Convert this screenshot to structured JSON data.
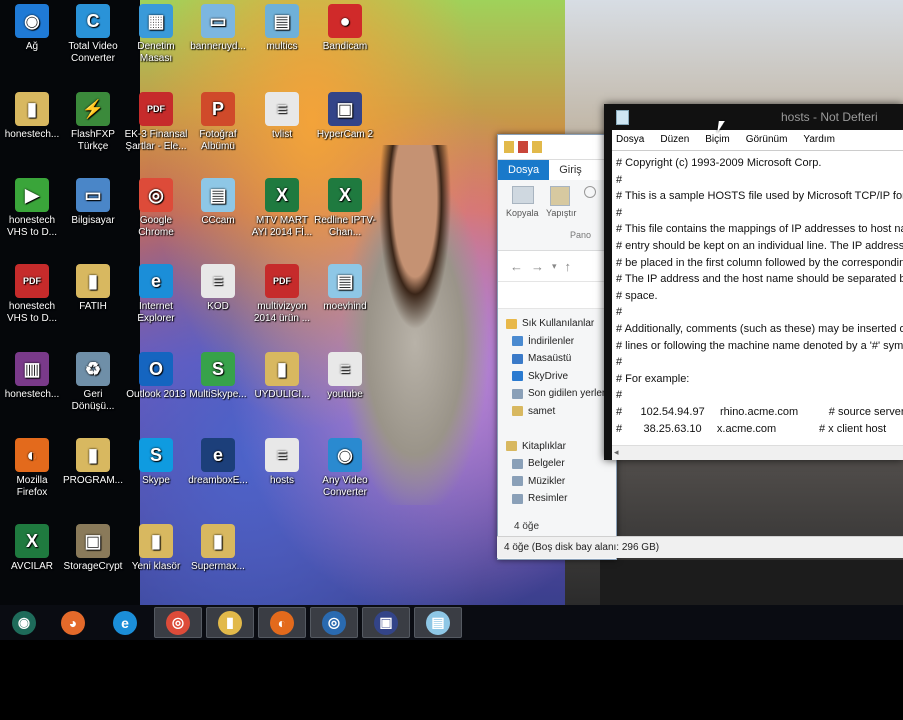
{
  "desktop": {
    "icons": [
      {
        "label": "Ağ",
        "icon": "network-icon",
        "color": "#1f7ad6",
        "glyph": "◉"
      },
      {
        "label": "Total Video Converter",
        "icon": "total-video-converter-icon",
        "color": "#2a93d8",
        "glyph": "C"
      },
      {
        "label": "Denetim Masası",
        "icon": "control-panel-icon",
        "color": "#3a9ad9",
        "glyph": "▦"
      },
      {
        "label": "banneruyd...",
        "icon": "image-file-icon",
        "color": "#7cb6e0",
        "glyph": "▭"
      },
      {
        "label": "multics",
        "icon": "document-icon",
        "color": "#6fb0d8",
        "glyph": "▤"
      },
      {
        "label": "Bandicam",
        "icon": "bandicam-icon",
        "color": "#d02a2a",
        "glyph": "●"
      },
      {
        "label": "honestech...",
        "icon": "folder-icon",
        "color": "#d8b860",
        "glyph": "▮"
      },
      {
        "label": "FlashFXP Türkçe",
        "icon": "flashfxp-icon",
        "color": "#3b8a3b",
        "glyph": "⚡"
      },
      {
        "label": "EK-3 Finansal Şartlar - Ele...",
        "icon": "pdf-icon",
        "color": "#c62b2b",
        "glyph": "PDF"
      },
      {
        "label": "Fotoğraf Albümü",
        "icon": "powerpoint-icon",
        "color": "#d04a2a",
        "glyph": "P"
      },
      {
        "label": "tvlist",
        "icon": "text-file-icon",
        "color": "#e8e8e8",
        "glyph": "≡"
      },
      {
        "label": "HyperCam 2",
        "icon": "hypercam-icon",
        "color": "#334488",
        "glyph": "▣"
      },
      {
        "label": "honestech VHS to D...",
        "icon": "honestech-icon",
        "color": "#3aa53a",
        "glyph": "▶"
      },
      {
        "label": "Bilgisayar",
        "icon": "computer-icon",
        "color": "#4a86c8",
        "glyph": "▭"
      },
      {
        "label": "Google Chrome",
        "icon": "chrome-icon",
        "color": "#dd4b39",
        "glyph": "◎"
      },
      {
        "label": "CCcam",
        "icon": "cccam-file-icon",
        "color": "#8ec7e6",
        "glyph": "▤"
      },
      {
        "label": "MTV MART AYI 2014 Fİ...",
        "icon": "excel-icon",
        "color": "#1f7a3f",
        "glyph": "X"
      },
      {
        "label": "Redline IPTV-Chan...",
        "icon": "excel-icon",
        "color": "#1f7a3f",
        "glyph": "X"
      },
      {
        "label": "honestech VHS to D...",
        "icon": "pdf-icon",
        "color": "#c62b2b",
        "glyph": "PDF"
      },
      {
        "label": "FATİH",
        "icon": "folder-icon",
        "color": "#d8b860",
        "glyph": "▮"
      },
      {
        "label": "Internet Explorer",
        "icon": "internet-explorer-icon",
        "color": "#1b8ed8",
        "glyph": "e"
      },
      {
        "label": "KOD",
        "icon": "text-file-icon",
        "color": "#e8e8e8",
        "glyph": "≡"
      },
      {
        "label": "multivizyon 2014 ürün ...",
        "icon": "pdf-icon",
        "color": "#c62b2b",
        "glyph": "PDF"
      },
      {
        "label": "moevhind",
        "icon": "cccam-file-icon",
        "color": "#8ec7e6",
        "glyph": "▤"
      },
      {
        "label": "honestech...",
        "icon": "winrar-icon",
        "color": "#7a3a8a",
        "glyph": "▥"
      },
      {
        "label": "Geri Dönüşü...",
        "icon": "recycle-bin-icon",
        "color": "#6f8fa8",
        "glyph": "♻"
      },
      {
        "label": "Outlook 2013",
        "icon": "outlook-icon",
        "color": "#1565c0",
        "glyph": "O"
      },
      {
        "label": "MultiSkype...",
        "icon": "multiskype-icon",
        "color": "#37a24a",
        "glyph": "S"
      },
      {
        "label": "UYDULICI...",
        "icon": "folder-icon",
        "color": "#d8b860",
        "glyph": "▮"
      },
      {
        "label": "youtube",
        "icon": "text-file-icon",
        "color": "#e8e8e8",
        "glyph": "≡"
      },
      {
        "label": "Mozilla Firefox",
        "icon": "firefox-icon",
        "color": "#e36a1c",
        "glyph": "◐"
      },
      {
        "label": "PROGRAM...",
        "icon": "folder-icon",
        "color": "#d8b860",
        "glyph": "▮"
      },
      {
        "label": "Skype",
        "icon": "skype-icon",
        "color": "#0f9be0",
        "glyph": "S"
      },
      {
        "label": "dreamboxE...",
        "icon": "dreambox-icon",
        "color": "#1c3f7a",
        "glyph": "e"
      },
      {
        "label": "hosts",
        "icon": "text-file-icon",
        "color": "#e8e8e8",
        "glyph": "≡"
      },
      {
        "label": "Any Video Converter",
        "icon": "any-video-converter-icon",
        "color": "#2a8ad0",
        "glyph": "◉"
      },
      {
        "label": "AVCILAR",
        "icon": "excel-icon",
        "color": "#1f7a3f",
        "glyph": "X"
      },
      {
        "label": "StorageCrypt",
        "icon": "storagecrypt-icon",
        "color": "#8a7a5a",
        "glyph": "▣"
      },
      {
        "label": "Yeni klasör",
        "icon": "folder-icon",
        "color": "#d8b860",
        "glyph": "▮"
      },
      {
        "label": "Supermax...",
        "icon": "folder-icon",
        "color": "#d8b860",
        "glyph": "▮"
      }
    ]
  },
  "explorer": {
    "tab_file": "Dosya",
    "tab_home": "Giriş",
    "copy_label": "Kopyala",
    "paste_label": "Yapıştır",
    "clipboard_group": "Pano",
    "tree": [
      {
        "label": "Sık Kullanılanlar",
        "color": "#e8b84a",
        "icon": "star-icon"
      },
      {
        "label": "İndirilenler",
        "color": "#4a8ad0",
        "icon": "downloads-icon"
      },
      {
        "label": "Masaüstü",
        "color": "#3a7ac8",
        "icon": "desktop-icon"
      },
      {
        "label": "SkyDrive",
        "color": "#2a7ad0",
        "icon": "skydrive-icon"
      },
      {
        "label": "Son gidilen yerler",
        "color": "#8aa0b8",
        "icon": "recent-places-icon"
      },
      {
        "label": "samet",
        "color": "#d8b860",
        "icon": "folder-icon"
      },
      {
        "label": "",
        "color": "",
        "icon": ""
      },
      {
        "label": "Kitaplıklar",
        "color": "#d8b860",
        "icon": "libraries-icon"
      },
      {
        "label": "Belgeler",
        "color": "#8aa0b8",
        "icon": "documents-icon"
      },
      {
        "label": "Müzikler",
        "color": "#8aa0b8",
        "icon": "music-icon"
      },
      {
        "label": "Resimler",
        "color": "#8aa0b8",
        "icon": "pictures-icon"
      }
    ],
    "item_count": "4 öğe",
    "status": "4 öğe (Boş disk bay alanı: 296 GB)"
  },
  "notepad": {
    "title": "hosts - Not Defteri",
    "menu": [
      "Dosya",
      "Düzen",
      "Biçim",
      "Görünüm",
      "Yardım"
    ],
    "lines": [
      "# Copyright (c) 1993-2009 Microsoft Corp.",
      "#",
      "# This is a sample HOSTS file used by Microsoft TCP/IP for Windows.",
      "#",
      "# This file contains the mappings of IP addresses to host names. Each",
      "# entry should be kept on an individual line. The IP address should",
      "# be placed in the first column followed by the corresponding host name.",
      "# The IP address and the host name should be separated by at least one",
      "# space.",
      "#",
      "# Additionally, comments (such as these) may be inserted on individual",
      "# lines or following the machine name denoted by a '#' symbol.",
      "#",
      "# For example:",
      "#",
      "#      102.54.94.97     rhino.acme.com          # source server",
      "#       38.25.63.10     x.acme.com              # x client host"
    ]
  },
  "taskbar": {
    "buttons": [
      {
        "name": "start-button",
        "icon": "windows-logo-icon",
        "color": "#1e6b5a",
        "glyph": "◉",
        "active": false
      },
      {
        "name": "taskbar-chrome-canary",
        "icon": "colorful-app-icon",
        "color": "#e46a2a",
        "glyph": "◕",
        "active": false
      },
      {
        "name": "taskbar-internet-explorer",
        "icon": "internet-explorer-icon",
        "color": "#1b8ed8",
        "glyph": "e",
        "active": false
      },
      {
        "name": "taskbar-google-chrome",
        "icon": "chrome-icon",
        "color": "#dd4b39",
        "glyph": "◎",
        "active": true
      },
      {
        "name": "taskbar-file-explorer",
        "icon": "file-explorer-icon",
        "color": "#e2b94a",
        "glyph": "▮",
        "active": true
      },
      {
        "name": "taskbar-firefox",
        "icon": "firefox-icon",
        "color": "#e36a1c",
        "glyph": "◐",
        "active": true
      },
      {
        "name": "taskbar-dreambox",
        "icon": "dreambox-icon",
        "color": "#2a6ab0",
        "glyph": "◎",
        "active": true
      },
      {
        "name": "taskbar-hypercam",
        "icon": "hypercam-icon",
        "color": "#334488",
        "glyph": "▣",
        "active": true
      },
      {
        "name": "taskbar-notepad",
        "icon": "notepad-icon",
        "color": "#8ec7e6",
        "glyph": "▤",
        "active": true
      }
    ]
  }
}
